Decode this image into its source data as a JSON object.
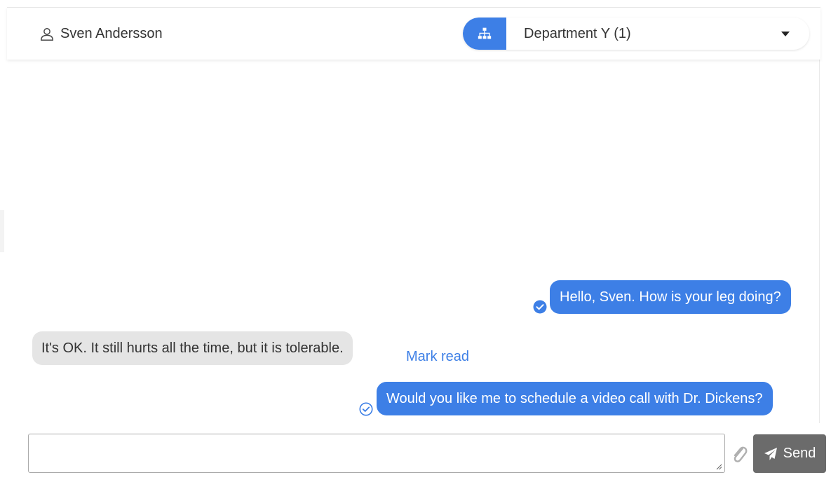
{
  "header": {
    "user_name": "Sven Andersson",
    "department_label": "Department Y (1)"
  },
  "messages": [
    {
      "direction": "out",
      "text": "Hello, Sven. How is your leg doing?",
      "read": true
    },
    {
      "direction": "in",
      "text": "It's OK. It still hurts all the time, but it is tolerable.",
      "action": "Mark read"
    },
    {
      "direction": "out",
      "text": "Would you like me to schedule a video call with Dr. Dickens?",
      "read": false
    }
  ],
  "composer": {
    "placeholder": "",
    "value": "",
    "send_label": "Send"
  },
  "colors": {
    "accent": "#3d7fe6",
    "incoming_bubble": "#e5e5e5",
    "send_button": "#6b6b6b"
  },
  "icons": [
    "user-icon",
    "org-chart-icon",
    "caret-down-icon",
    "check-filled-icon",
    "check-outline-icon",
    "paperclip-icon",
    "paper-plane-icon"
  ]
}
